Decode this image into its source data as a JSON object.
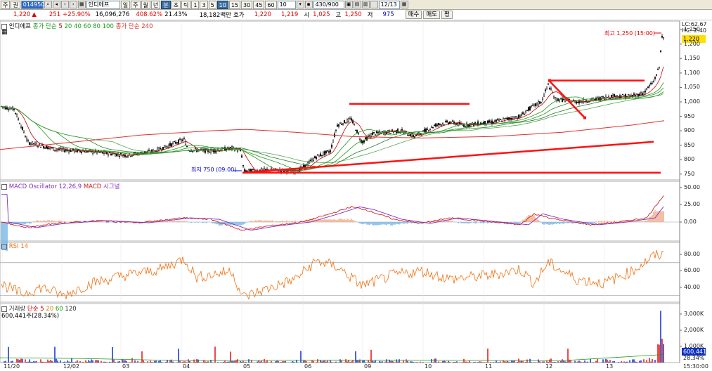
{
  "toolbar": {
    "items": [
      "주",
      "권"
    ],
    "code": "014950",
    "name": "인디에프",
    "period_buttons": [
      "일",
      "주",
      "월",
      "년",
      "분",
      "초",
      "틱"
    ],
    "minute_buttons": [
      "1",
      "3",
      "5",
      "10",
      "15",
      "30",
      "45",
      "60"
    ],
    "selected_minute": "10",
    "count_value": "10",
    "range_text": "430/900",
    "date_value": "12/13"
  },
  "info": {
    "price": "1,220",
    "arrow": "▲",
    "change": "251",
    "change_pct": "+25.90%",
    "volume": "16,096,276",
    "vol_ratio": "408.62%",
    "turnover": "21.43%",
    "amount": "18,182백만",
    "quote_label": "호가",
    "quote_price": "1,220",
    "quote_bid": "1,219",
    "open_label": "시",
    "open": "1,025",
    "high_label": "고",
    "high": "1,250",
    "low_label": "저",
    "low": "975",
    "buy_label": "매수",
    "sell_label": "매도",
    "flat_label": "평"
  },
  "price_panel": {
    "legend_name": "인디에프",
    "legend_ma_label": "종가 단순",
    "legend_ma_periods": [
      "5",
      "20",
      "40",
      "60",
      "80",
      "100"
    ],
    "legend_ma2": "종가 단순 240",
    "lc": "LC:62.67",
    "hc": "HC:-2.40",
    "current": "1,220",
    "axis": [
      "1,250",
      "1,200",
      "1,150",
      "1,100",
      "1,050",
      "1,000",
      "950",
      "900",
      "850",
      "800",
      "750"
    ],
    "high_note": "최고 1,250 (15:00)",
    "low_note": "최저 750 (09:00)"
  },
  "macd_panel": {
    "title": "MACD Oscillator 12,26,9",
    "macd": "MACD",
    "signal": "시그널",
    "axis": [
      "50.00",
      "25.00",
      "0.00"
    ]
  },
  "rsi_panel": {
    "title": "RSI 14",
    "axis": [
      "80.00",
      "60.00",
      "40.00"
    ]
  },
  "volume_panel": {
    "title": "거래량",
    "ma_label": "단순",
    "ma_periods": [
      "5",
      "20",
      "60",
      "120"
    ],
    "value": "600,441주(28.34%)",
    "axis": [
      "3,000K",
      "2,000K",
      "1,000K"
    ],
    "current": "600,441",
    "current_pct": "28.34%"
  },
  "xaxis": [
    "11/20",
    "12/02",
    "03",
    "04",
    "05",
    "06",
    "09",
    "10",
    "11",
    "12",
    "13"
  ],
  "time_label": "15:30:00",
  "colors": {
    "up": "#e00000",
    "down": "#0000d0",
    "ma5": "#c00000",
    "ma_green": "#1a9a1a",
    "ma240": "#e03030",
    "macd": "#d02020",
    "signal": "#8030c0",
    "rsi": "#f07010"
  }
}
